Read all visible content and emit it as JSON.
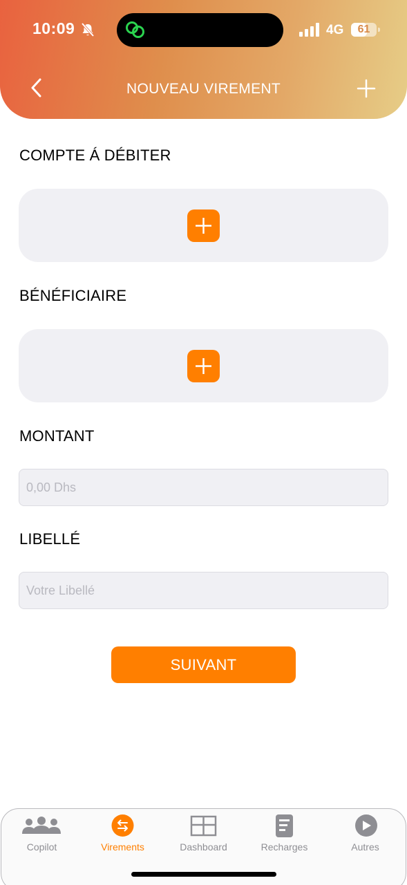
{
  "status_bar": {
    "time": "10:09",
    "network": "4G",
    "battery": "61",
    "battery_level": 0.61
  },
  "header": {
    "title": "NOUVEAU VIREMENT",
    "back_icon": "chevron-left-icon",
    "add_icon": "plus-icon"
  },
  "form": {
    "debit_account_label": "COMPTE Á DÉBITER",
    "beneficiary_label": "BÉNÉFICIAIRE",
    "amount_label": "MONTANT",
    "amount_placeholder": "0,00 Dhs",
    "amount_value": "",
    "wording_label": "LIBELLÉ",
    "wording_placeholder": "Votre Libellé",
    "wording_value": "",
    "next_label": "SUIVANT"
  },
  "tabbar": {
    "items": [
      {
        "label": "Copilot",
        "icon": "group-icon",
        "active": false
      },
      {
        "label": "Virements",
        "icon": "transfer-icon",
        "active": true
      },
      {
        "label": "Dashboard",
        "icon": "dashboard-icon",
        "active": false
      },
      {
        "label": "Recharges",
        "icon": "document-icon",
        "active": false
      },
      {
        "label": "Autres",
        "icon": "play-circle-icon",
        "active": false
      }
    ]
  },
  "colors": {
    "accent": "#FF7F00",
    "field_bg": "#F0F0F4",
    "inactive_tab": "#8E8E93"
  }
}
